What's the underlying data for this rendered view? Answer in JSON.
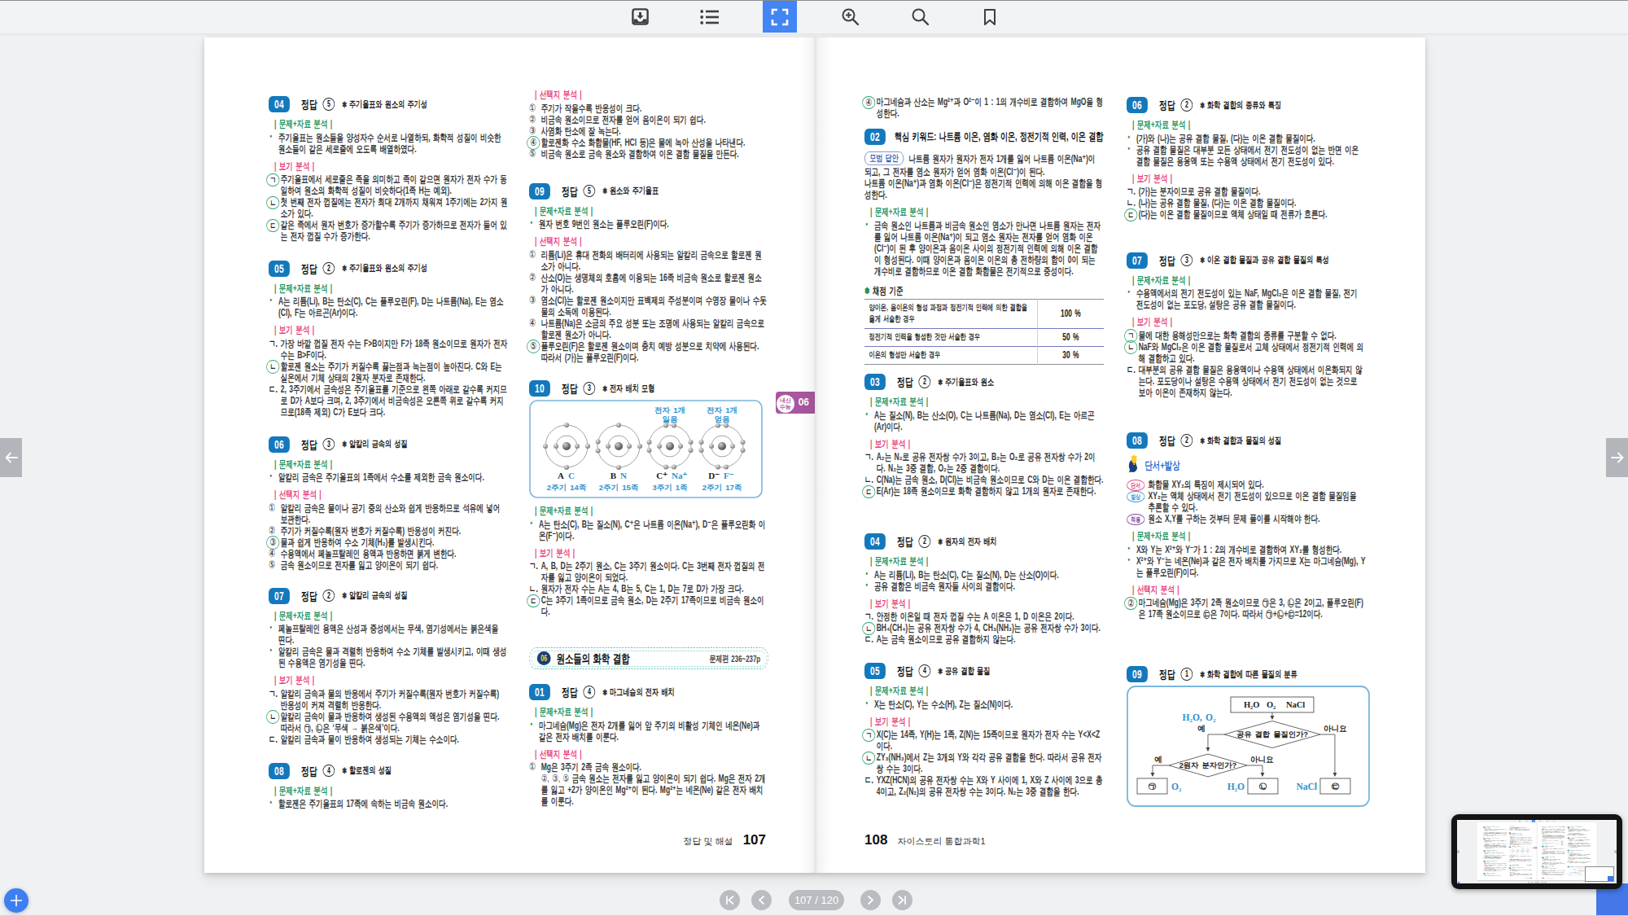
{
  "toolbar": {
    "buttons": [
      {
        "icon": "download"
      },
      {
        "icon": "toc-list"
      },
      {
        "icon": "fullscreen",
        "active": true
      },
      {
        "icon": "zoom-in"
      },
      {
        "icon": "search"
      },
      {
        "icon": "bookmark"
      }
    ]
  },
  "bottom_nav": {
    "page_indicator": "107 / 120"
  },
  "colors": {
    "accent_blue": "#4285f4",
    "badge_blue": "#1478bd",
    "analysis_green": "#19945e",
    "analysis_pink": "#e8437e",
    "tab_purple": "#a8569f",
    "figure_blue": "#2e93cf"
  },
  "labels": {
    "explain_problem": "문제+자료 분석",
    "explain_choices": "선택지 분석",
    "explain_bogi": "보기 분석",
    "answer_word": "정답"
  },
  "left_page": {
    "footer": {
      "label": "정답 및 해설",
      "page": "107"
    },
    "side_tab": {
      "line1": "내신",
      "line2": "수능",
      "num": "06"
    },
    "col1": [
      {
        "head": {
          "num": "04",
          "ans": "⑤",
          "topic": "주기율표와 원소의 주기성"
        },
        "blocks": [
          {
            "t": "sub",
            "c": "green",
            "x": "문제+자료 분석"
          },
          {
            "t": "bullet",
            "x": "주기율표는 원소들을 양성자수 순서로 나열하되, 화학적 성질이 비슷한 원소들이 같은 세로줄에 오도록 배열하였다."
          },
          {
            "t": "sub",
            "c": "pink",
            "x": "보기 분석"
          },
          {
            "t": "item",
            "m": "ㄱ",
            "circ": true,
            "x": "주기율표에서 세로줄은 족을 의미하고 족이 같으면 원자가 전자 수가 동일하여 원소의 화학적 성질이 비슷하다(1족 H는 예외)."
          },
          {
            "t": "item",
            "m": "ㄴ",
            "circ": true,
            "x": "첫 번째 전자 껍질에는 전자가 최대 2개까지 채워져 1주기에는 2가지 원소가 있다."
          },
          {
            "t": "item",
            "m": "ㄷ",
            "circ": true,
            "x": "같은 족에서 원자 번호가 증가할수록 주기가 증가하므로 전자가 들어 있는 전자 껍질 수가 증가한다."
          }
        ]
      },
      {
        "head": {
          "num": "05",
          "ans": "②",
          "topic": "주기율표와 원소의 주기성"
        },
        "blocks": [
          {
            "t": "sub",
            "c": "green",
            "x": "문제+자료 분석"
          },
          {
            "t": "bullet",
            "x": "A는 리튬(Li), B는 탄소(C), C는 플루오린(F), D는 나트륨(Na), E는 염소(Cl), F는 아르곤(Ar)이다."
          },
          {
            "t": "sub",
            "c": "pink",
            "x": "보기 분석"
          },
          {
            "t": "item",
            "m": "ㄱ.",
            "x": "가장 바깥 껍질 전자 수는 F>B이지만 F가 18족 원소이므로 원자가 전자 수는 B>F이다."
          },
          {
            "t": "item",
            "m": "ㄴ",
            "circ": true,
            "x": "할로젠 원소는 주기가 커질수록 끓는점과 녹는점이 높아진다. C와 E는 실온에서 기체 상태의 2원자 분자로 존재한다."
          },
          {
            "t": "item",
            "m": "ㄷ.",
            "x": "2, 3주기에서 금속성은 주기율표를 기준으로 왼쪽 아래로 갈수록 커지므로 D가 A보다 크며, 2, 3주기에서 비금속성은 오른쪽 위로 갈수록 커지므로(18족 제외) C가 E보다 크다."
          }
        ]
      },
      {
        "head": {
          "num": "06",
          "ans": "③",
          "topic": "알칼리 금속의 성질"
        },
        "blocks": [
          {
            "t": "sub",
            "c": "green",
            "x": "문제+자료 분석"
          },
          {
            "t": "bullet",
            "x": "알칼리 금속은 주기율표의 1족에서 수소를 제외한 금속 원소이다."
          },
          {
            "t": "sub",
            "c": "pink",
            "x": "선택지 분석"
          },
          {
            "t": "item",
            "m": "①",
            "num": true,
            "x": "알칼리 금속은 물이나 공기 중의 산소와 쉽게 반응하므로 석유에 넣어 보관한다."
          },
          {
            "t": "item",
            "m": "②",
            "num": true,
            "x": "주기가 커질수록(원자 번호가 커질수록) 반응성이 커진다."
          },
          {
            "t": "item",
            "m": "③",
            "num": true,
            "circ": true,
            "x": "물과 쉽게 반응하여 수소 기체(H₂)를 발생시킨다."
          },
          {
            "t": "item",
            "m": "④",
            "num": true,
            "x": "수용액에서 페놀프탈레인 용액과 반응하면 붉게 변한다."
          },
          {
            "t": "item",
            "m": "⑤",
            "num": true,
            "x": "금속 원소이므로 전자를 잃고 양이온이 되기 쉽다."
          }
        ]
      },
      {
        "head": {
          "num": "07",
          "ans": "②",
          "topic": "알칼리 금속의 성질"
        },
        "blocks": [
          {
            "t": "sub",
            "c": "green",
            "x": "문제+자료 분석"
          },
          {
            "t": "bullet",
            "x": "페놀프탈레인 용액은 산성과 중성에서는 무색, 염기성에서는 붉은색을 띤다."
          },
          {
            "t": "bullet",
            "x": "알칼리 금속은 물과 격렬히 반응하여 수소 기체를 발생시키고, 이때 생성된 수용액은 염기성을 띤다."
          },
          {
            "t": "sub",
            "c": "pink",
            "x": "보기 분석"
          },
          {
            "t": "item",
            "m": "ㄱ.",
            "x": "알칼리 금속과 물의 반응에서 주기가 커질수록(원자 번호가 커질수록) 반응성이 커져 격렬히 반응한다."
          },
          {
            "t": "item",
            "m": "ㄴ",
            "circ": true,
            "x": "알칼리 금속이 물과 반응하여 생성된 수용액의 액성은 염기성을 띤다. 따라서 ㉠, ㉡은 ‘무색 → 붉은색’이다."
          },
          {
            "t": "item",
            "m": "ㄷ.",
            "x": "알칼리 금속과 물이 반응하여 생성되는 기체는 수소이다."
          }
        ]
      },
      {
        "head": {
          "num": "08",
          "ans": "④",
          "topic": "할로젠의 성질"
        },
        "blocks": [
          {
            "t": "sub",
            "c": "green",
            "x": "문제+자료 분석"
          },
          {
            "t": "bullet",
            "x": "할로젠은 주기율표의 17족에 속하는 비금속 원소이다."
          }
        ]
      }
    ],
    "col2": [
      {
        "blocks": [
          {
            "t": "sub",
            "c": "pink",
            "x": "선택지 분석"
          },
          {
            "t": "item",
            "m": "①",
            "num": true,
            "x": "주기가 작을수록 반응성이 크다."
          },
          {
            "t": "item",
            "m": "②",
            "num": true,
            "x": "비금속 원소이므로 전자를 얻어 음이온이 되기 쉽다."
          },
          {
            "t": "item",
            "m": "③",
            "num": true,
            "x": "사염화 탄소에 잘 녹는다."
          },
          {
            "t": "item",
            "m": "④",
            "num": true,
            "circ": true,
            "x": "할로젠화 수소 화합물(HF, HCl 등)은 물에 녹아 산성을 나타낸다."
          },
          {
            "t": "item",
            "m": "⑤",
            "num": true,
            "x": "비금속 원소로 금속 원소와 결합하여 이온 결합 물질을 만든다."
          }
        ]
      },
      {
        "head": {
          "num": "09",
          "ans": "⑤",
          "topic": "원소와 주기율표"
        },
        "blocks": [
          {
            "t": "sub",
            "c": "green",
            "x": "문제+자료 분석"
          },
          {
            "t": "bullet",
            "x": "원자 번호 9번인 원소는 플루오린(F)이다."
          },
          {
            "t": "sub",
            "c": "pink",
            "x": "선택지 분석"
          },
          {
            "t": "item",
            "m": "①",
            "num": true,
            "x": "리튬(Li)은 휴대 전화의 배터리에 사용되는 알칼리 금속으로 할로젠 원소가 아니다."
          },
          {
            "t": "item",
            "m": "②",
            "num": true,
            "x": "산소(O)는 생명체의 호흡에 이용되는 16족 비금속 원소로 할로젠 원소가 아니다."
          },
          {
            "t": "item",
            "m": "③",
            "num": true,
            "x": "염소(Cl)는 할로젠 원소이지만 표백제의 주성분이며 수영장 물이나 수돗물의 소독에 이용된다."
          },
          {
            "t": "item",
            "m": "④",
            "num": true,
            "x": "나트륨(Na)은 소금의 주요 성분 또는 조명에 사용되는 알칼리 금속으로 할로젠 원소가 아니다."
          },
          {
            "t": "item",
            "m": "⑤",
            "num": true,
            "circ": true,
            "x": "플루오린(F)은 할로젠 원소이며 충치 예방 성분으로 치약에 사용된다. 따라서 (가)는 플루오린(F)이다."
          }
        ]
      },
      {
        "head": {
          "num": "10",
          "ans": "③",
          "topic": "전자 배치 모형"
        },
        "blocks": [
          {
            "t": "figAtoms",
            "atoms": [
              {
                "note1": "",
                "note2": "",
                "name": "A",
                "elem": "C",
                "info": "2주기 14족",
                "inner": 2,
                "outer": 4
              },
              {
                "note1": "",
                "note2": "",
                "name": "B",
                "elem": "N",
                "info": "2주기 15족",
                "inner": 2,
                "outer": 5
              },
              {
                "note1": "전자 1개",
                "note2": "잃음",
                "name": "C⁺",
                "elem": "Na⁺",
                "info": "3주기 1족",
                "inner": 2,
                "outer": 8
              },
              {
                "note1": "전자 1개",
                "note2": "얻음",
                "name": "D⁻",
                "elem": "F⁻",
                "info": "2주기 17족",
                "inner": 2,
                "outer": 8
              }
            ]
          },
          {
            "t": "sub",
            "c": "green",
            "x": "문제+자료 분석"
          },
          {
            "t": "bullet",
            "x": "A는 탄소(C), B는 질소(N), C⁺은 나트륨 이온(Na⁺), D⁻은 플루오린화 이온(F⁻)이다."
          },
          {
            "t": "sub",
            "c": "pink",
            "x": "보기 분석"
          },
          {
            "t": "item",
            "m": "ㄱ.",
            "x": "A, B, D는 2주기 원소, C는 3주기 원소이다. C는 3번째 전자 껍질의 전자를 잃고 양이온이 되었다."
          },
          {
            "t": "item",
            "m": "ㄴ.",
            "x": "원자가 전자 수는 A는 4, B는 5, C는 1, D는 7로 D가 가장 크다."
          },
          {
            "t": "item",
            "m": "ㄷ",
            "circ": true,
            "x": "C는 3주기 1족이므로 금속 원소, D는 2주기 17족이므로 비금속 원소이다."
          }
        ]
      },
      {
        "unit": {
          "num": "06",
          "title": "원소들의 화학 결합",
          "ref": "문제편 236~237p"
        },
        "blocks": []
      },
      {
        "head": {
          "num": "01",
          "ans": "④",
          "topic": "마그네슘의 전자 배치"
        },
        "blocks": [
          {
            "t": "sub",
            "c": "green",
            "x": "문제+자료 분석"
          },
          {
            "t": "bullet",
            "x": "마그네슘(Mg)은 전자 2개를 잃어 앞 주기의 비활성 기체인 네온(Ne)과 같은 전자 배치를 이룬다."
          },
          {
            "t": "sub",
            "c": "pink",
            "x": "선택지 분석"
          },
          {
            "t": "item",
            "m": "①",
            "num": true,
            "x": "Mg은 3주기 2족 금속 원소이다."
          },
          {
            "t": "item",
            "m": "②, ③, ⑤",
            "num": true,
            "inline": true,
            "x": "금속 원소는 전자를 잃고 양이온이 되기 쉽다. Mg은 전자 2개를 잃고 +2가 양이온인 Mg²⁺이 된다. Mg²⁺는 네온(Ne) 같은 전자 배치를 이룬다."
          }
        ]
      }
    ]
  },
  "right_page": {
    "footer": {
      "page": "108",
      "label": "자이스토리 통합과학1"
    },
    "col1": [
      {
        "blocks": [
          {
            "t": "item",
            "m": "④",
            "num": true,
            "circ": true,
            "x": "마그네슘과 산소는 Mg²⁺과 O²⁻이 1 : 1의 개수비로 결합하여 MgO을 형성한다."
          }
        ]
      },
      {
        "kw": {
          "num": "02",
          "title": "핵심 키워드: 나트륨 이온, 염화 이온, 정전기적 인력, 이온 결합"
        },
        "blocks": [
          {
            "t": "model",
            "badge": "모범 답안",
            "x": "나트륨 원자가 원자가 전자 1개를 잃어 나트륨 이온(Na⁺)이 되고, 그 전자를 염소 원자가 얻어 염화 이온(Cl⁻)이 된다."
          },
          {
            "t": "plain",
            "x": "나트륨 이온(Na⁺)과 염화 이온(Cl⁻)은 정전기적 인력에 의해 이온 결합을 형성한다."
          },
          {
            "t": "sub",
            "c": "green",
            "x": "문제+자료 분석"
          },
          {
            "t": "bullet",
            "x": "금속 원소인 나트륨과 비금속 원소인 염소가 만나면 나트륨 원자는 전자를 잃어 나트륨 이온(Na⁺)이 되고 염소 원자는 전자를 얻어 염화 이온(Cl⁻)이 된 후 양이온과 음이온 사이의 정전기적 인력에 의해 이온 결합이 형성된다. 이때 양이온과 음이온 이온의 총 전하량의 합이 0이 되는 개수비로 결합하므로 이온 결합 화합물은 전기적으로 중성이다."
          },
          {
            "t": "gtitle",
            "x": "채점 기준"
          },
          {
            "t": "table",
            "rows": [
              {
                "x": "양이온, 음이온의 형성 과정과 정전기적 인력에 의한 결합을 옳게 서술한 경우",
                "pct": "100 %"
              },
              {
                "x": "정전기적 인력을 형성한 것만 서술한 경우",
                "pct": "50 %"
              },
              {
                "x": "이온의 형성만 서술한 경우",
                "pct": "30 %"
              }
            ]
          }
        ]
      },
      {
        "head": {
          "num": "03",
          "ans": "②",
          "topic": "주기율표와 원소"
        },
        "blocks": [
          {
            "t": "sub",
            "c": "green",
            "x": "문제+자료 분석"
          },
          {
            "t": "bullet",
            "x": "A는 질소(N), B는 산소(O), C는 나트륨(Na), D는 염소(Cl), E는 아르곤(Ar)이다."
          },
          {
            "t": "sub",
            "c": "pink",
            "x": "보기 분석"
          },
          {
            "t": "item",
            "m": "ㄱ.",
            "x": "A₂는 N₂로 공유 전자쌍 수가 3이고, B₂는 O₂로 공유 전자쌍 수가 2이다. N₂는 3중 결합, O₂는 2중 결합이다."
          },
          {
            "t": "item",
            "m": "ㄴ.",
            "x": "C(Na)는 금속 원소, D(Cl)는 비금속 원소이므로 C와 D는 이온 결합한다."
          },
          {
            "t": "item",
            "m": "ㄷ",
            "circ": true,
            "x": "E(Ar)는 18족 원소이므로 화학 결합하지 않고 1개의 원자로 존재한다."
          }
        ]
      },
      {
        "head": {
          "num": "04",
          "ans": "②",
          "topic": "원자의 전자 배치"
        },
        "blocks": [
          {
            "t": "sub",
            "c": "green",
            "x": "문제+자료 분석"
          },
          {
            "t": "bullet",
            "x": "A는 리튬(Li), B는 탄소(C), C는 질소(N), D는 산소(O)이다."
          },
          {
            "t": "bullet",
            "x": "공유 결합은 비금속 원자들 사이의 결합이다."
          },
          {
            "t": "sub",
            "c": "pink",
            "x": "보기 분석"
          },
          {
            "t": "item",
            "m": "ㄱ.",
            "x": "안정한 이온일 때 전자 껍질 수는 A 이온은 1, D 이온은 2이다."
          },
          {
            "t": "item",
            "m": "ㄴ",
            "circ": true,
            "x": "BH₄(CH₄)는 공유 전자쌍 수가 4, CH₃(NH₃)는 공유 전자쌍 수가 3이다."
          },
          {
            "t": "item",
            "m": "ㄷ.",
            "x": "A는 금속 원소이므로 공유 결합하지 않는다."
          }
        ]
      },
      {
        "head": {
          "num": "05",
          "ans": "④",
          "topic": "공유 결합 물질"
        },
        "blocks": [
          {
            "t": "sub",
            "c": "green",
            "x": "문제+자료 분석"
          },
          {
            "t": "bullet",
            "x": "X는 탄소(C), Y는 수소(H), Z는 질소(N)이다."
          },
          {
            "t": "sub",
            "c": "pink",
            "x": "보기 분석"
          },
          {
            "t": "item",
            "m": "ㄱ",
            "circ": true,
            "x": "X(C)는 14족, Y(H)는 1족, Z(N)는 15족이므로 원자가 전자 수는 Y<X<Z이다."
          },
          {
            "t": "item",
            "m": "ㄴ",
            "circ": true,
            "x": "ZY₃(NH₃)에서 Z는 3개의 Y와 각각 공유 결합을 한다. 따라서 공유 전자쌍 수는 3이다."
          },
          {
            "t": "item",
            "m": "ㄷ.",
            "x": "YXZ(HCN)의 공유 전자쌍 수는 X와 Y 사이에 1, X와 Z 사이에 3으로 총 4이고, Z₂(N₂)의 공유 전자쌍 수는 3이다. N₂는 3중 결합을 한다."
          }
        ]
      }
    ],
    "col2": [
      {
        "head": {
          "num": "06",
          "ans": "②",
          "topic": "화학 결합의 종류와 특징"
        },
        "blocks": [
          {
            "t": "sub",
            "c": "green",
            "x": "문제+자료 분석"
          },
          {
            "t": "bullet",
            "x": "(가)와 (나)는 공유 결합 물질, (다)는 이온 결합 물질이다."
          },
          {
            "t": "bullet",
            "x": "공유 결합 물질은 대부분 모든 상태에서 전기 전도성이 없는 반면 이온 결합 물질은 용융액 또는 수용액 상태에서 전기 전도성이 있다."
          },
          {
            "t": "sub",
            "c": "pink",
            "x": "보기 분석"
          },
          {
            "t": "item",
            "m": "ㄱ.",
            "x": "(가)는 분자이므로 공유 결합 물질이다."
          },
          {
            "t": "item",
            "m": "ㄴ.",
            "x": "(나)는 공유 결합 물질, (다)는 이온 결합 물질이다."
          },
          {
            "t": "item",
            "m": "ㄷ",
            "circ": true,
            "x": "(다)는 이온 결합 물질이므로 액체 상태일 때 전류가 흐른다."
          }
        ]
      },
      {
        "head": {
          "num": "07",
          "ans": "③",
          "topic": "이온 결합 물질과 공유 결합 물질의 특성"
        },
        "blocks": [
          {
            "t": "sub",
            "c": "green",
            "x": "문제+자료 분석"
          },
          {
            "t": "bullet",
            "x": "수용액에서의 전기 전도성이 있는 NaF, MgCl₂은 이온 결합 물질, 전기 전도성이 없는 포도당, 설탕은 공유 결합 물질이다."
          },
          {
            "t": "sub",
            "c": "pink",
            "x": "보기 분석"
          },
          {
            "t": "item",
            "m": "ㄱ",
            "circ": true,
            "x": "물에 대한 용해성만으로는 화학 결합의 종류를 구분할 수 없다."
          },
          {
            "t": "item",
            "m": "ㄴ",
            "circ": true,
            "x": "NaF와 MgCl₂은 이온 결합 물질로서 고체 상태에서 정전기적 인력에 의해 결합하고 있다."
          },
          {
            "t": "item",
            "m": "ㄷ.",
            "x": "대부분의 공유 결합 물질은 용융액이나 수용액 상태에서 이온화되지 않는다. 포도당이나 설탕은 수용액 상태에서 전기 전도성이 없는 것으로 보아 이온이 존재하지 않는다."
          }
        ]
      },
      {
        "head": {
          "num": "08",
          "ans": "②",
          "topic": "화학 결합과 물질의 성질"
        },
        "blocks": [
          {
            "t": "cluehead",
            "x": "단서+발상"
          },
          {
            "t": "clue",
            "badge": "단서",
            "c": "pink",
            "x": "화합물 XY₂의 특징이 제시되어 있다."
          },
          {
            "t": "clue",
            "badge": "발상",
            "c": "blue",
            "x": "XY₂는 액체 상태에서 전기 전도성이 있으므로 이온 결합 물질임을 추론할 수 있다."
          },
          {
            "t": "clue",
            "badge": "적용",
            "c": "purple",
            "x": "원소 X,Y를 구하는 것부터 문제 풀이를 시작해야 한다."
          },
          {
            "t": "sub",
            "c": "green",
            "x": "문제+자료 분석"
          },
          {
            "t": "bullet",
            "x": "X와 Y는 X²⁺와 Y⁻가 1 : 2의 개수비로 결합하여 XY₂를 형성한다."
          },
          {
            "t": "bullet",
            "x": "X²⁺와 Y⁻는 네온(Ne)과 같은 전자 배치를 가지므로 X는 마그네슘(Mg), Y는 플루오린(F)이다."
          },
          {
            "t": "sub",
            "c": "pink",
            "x": "선택지 분석"
          },
          {
            "t": "item",
            "m": "②",
            "num": true,
            "circ": true,
            "x": "마그네슘(Mg)은 3주기 2족 원소이므로 ㉠은 3, ㉡은 2이고, 플루오린(F)은 17족 원소이므로 ㉢은 7이다. 따라서 ㉠+㉡+㉢=12이다."
          }
        ]
      },
      {
        "head": {
          "num": "09",
          "ans": "①",
          "topic": "화학 결합에 따른 물질의 분류"
        },
        "blocks": [
          {
            "t": "figFlow",
            "source": [
              "H₂O",
              "O₂",
              "NaCl"
            ],
            "q1": "공유 결합 물질인가?",
            "q2": "2원자 분자인가?",
            "yes": "예",
            "no": "아니요",
            "branch_label": "H₂O, O₂",
            "r1": "㉠",
            "r1label": "O₂",
            "r2": "㉡",
            "r2label": "H₂O",
            "r3": "㉢",
            "r3label": "NaCl"
          }
        ]
      }
    ]
  }
}
